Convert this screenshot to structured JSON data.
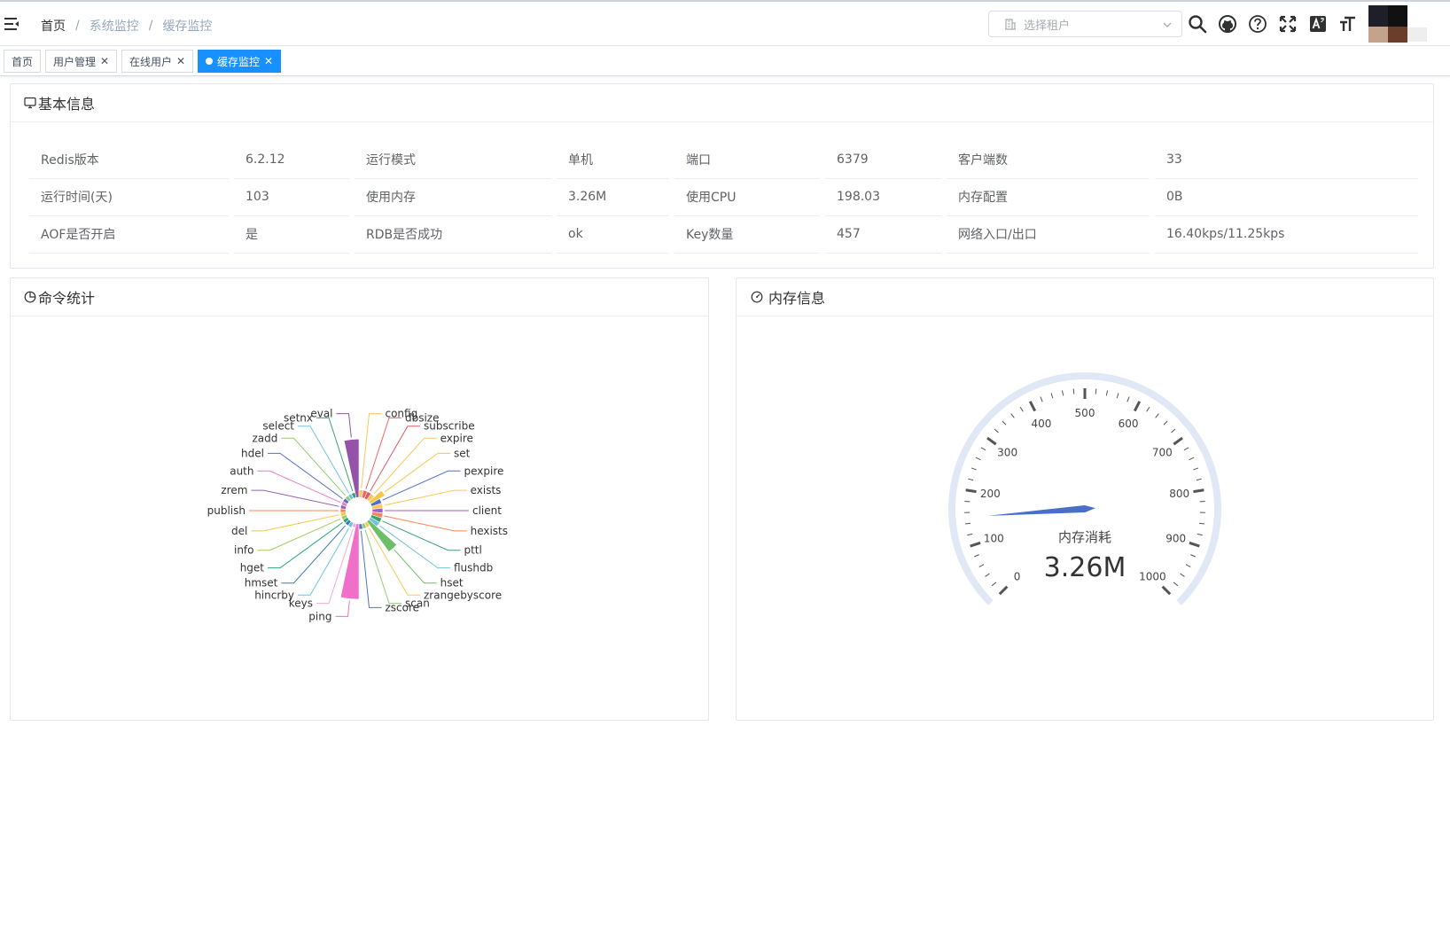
{
  "breadcrumb": [
    "首页",
    "系统监控",
    "缓存监控"
  ],
  "tenant": {
    "placeholder": "选择租户"
  },
  "nav_icons": [
    "search-icon",
    "github-icon",
    "question-icon",
    "fullscreen-icon",
    "translate-icon",
    "font-size-icon"
  ],
  "tags": [
    {
      "label": "首页",
      "closable": false,
      "active": false
    },
    {
      "label": "用户管理",
      "closable": true,
      "active": false
    },
    {
      "label": "在线用户",
      "closable": true,
      "active": false
    },
    {
      "label": "缓存监控",
      "closable": true,
      "active": true
    }
  ],
  "basic_info": {
    "title": "基本信息",
    "rows": [
      [
        "Redis版本",
        "6.2.12",
        "运行模式",
        "单机",
        "端口",
        "6379",
        "客户端数",
        "33"
      ],
      [
        "运行时间(天)",
        "103",
        "使用内存",
        "3.26M",
        "使用CPU",
        "198.03",
        "内存配置",
        "0B"
      ],
      [
        "AOF是否开启",
        "是",
        "RDB是否成功",
        "ok",
        "Key数量",
        "457",
        "网络入口/出口",
        "16.40kps/11.25kps"
      ]
    ]
  },
  "command_stats": {
    "title": "命令统计"
  },
  "memory_info": {
    "title": "内存信息"
  },
  "colors": {
    "accent": "#1890ff",
    "gauge_track": "#e1e8f5",
    "gauge_pointer": "#4a6fc9"
  },
  "chart_data": [
    {
      "type": "pie",
      "subtype": "nightingale-rose",
      "labels": [
        "ping",
        "keys",
        "hincrby",
        "hmset",
        "hget",
        "info",
        "del",
        "publish",
        "zrem",
        "auth",
        "hdel",
        "zadd",
        "select",
        "setnx",
        "eval",
        "config",
        "dbsize",
        "subscribe",
        "expire",
        "set",
        "pexpire",
        "exists",
        "client",
        "hexists",
        "pttl",
        "flushdb",
        "hset",
        "zrangebyscore",
        "scan",
        "zscore"
      ],
      "values": [
        100,
        0.3,
        0.5,
        0.5,
        0.5,
        0.5,
        0.5,
        0.5,
        0.5,
        0.5,
        0.5,
        0.5,
        0.5,
        0.5,
        60,
        1,
        1,
        1,
        1,
        5,
        2,
        2,
        2,
        2,
        2,
        2,
        25,
        0.5,
        0.5,
        0.5
      ],
      "colors": [
        "#f06fc8",
        "#f7a7d8",
        "#68c4e6",
        "#3b7ab8",
        "#2aa67a",
        "#a0c95a",
        "#f3c84b",
        "#fc8452",
        "#9a60b4",
        "#ea7ccc",
        "#5470c6",
        "#91cc75",
        "#73c0de",
        "#3ba272",
        "#9452a8",
        "#fac858",
        "#ee6666",
        "#e15767",
        "#fac858",
        "#f3c84b",
        "#5470c6",
        "#fac858",
        "#a55fc0",
        "#fc8452",
        "#3ba272",
        "#73c0de",
        "#6dbf67",
        "#fac858",
        "#91cc75",
        "#5470c6"
      ]
    },
    {
      "type": "gauge",
      "name": "内存消耗",
      "value": 3.26,
      "display": "3.26M",
      "min": 0,
      "max": 1000,
      "tick_labels": [
        "0",
        "100",
        "200",
        "300",
        "400",
        "500",
        "600",
        "700",
        "800",
        "900",
        "1000"
      ]
    }
  ]
}
